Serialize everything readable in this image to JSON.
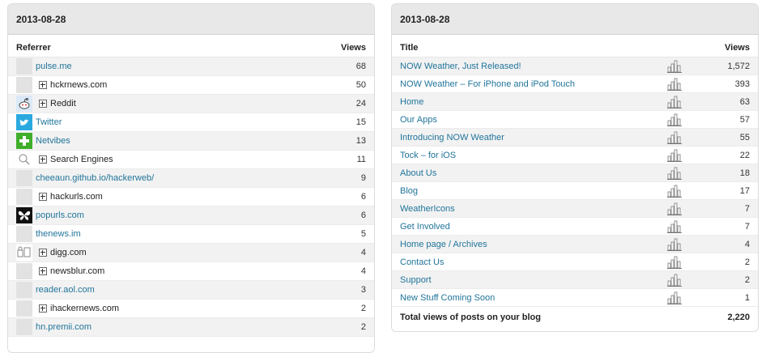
{
  "left": {
    "date": "2013-08-28",
    "col_referrer": "Referrer",
    "col_views": "Views",
    "rows": [
      {
        "label": "pulse.me",
        "views": "68",
        "kind": "link",
        "icon": "blank-icon"
      },
      {
        "label": "hckrnews.com",
        "views": "50",
        "kind": "expand",
        "icon": "blank-icon"
      },
      {
        "label": "Reddit",
        "views": "24",
        "kind": "expand",
        "icon": "reddit-icon"
      },
      {
        "label": "Twitter",
        "views": "15",
        "kind": "link",
        "icon": "twitter-icon"
      },
      {
        "label": "Netvibes",
        "views": "13",
        "kind": "link",
        "icon": "netvibes-icon"
      },
      {
        "label": "Search Engines",
        "views": "11",
        "kind": "expand",
        "icon": "search-icon"
      },
      {
        "label": "cheeaun.github.io/hackerweb/",
        "views": "9",
        "kind": "link",
        "icon": "blank-icon"
      },
      {
        "label": "hackurls.com",
        "views": "6",
        "kind": "expand",
        "icon": "blank-icon"
      },
      {
        "label": "popurls.com",
        "views": "6",
        "kind": "link",
        "icon": "popurls-icon"
      },
      {
        "label": "thenews.im",
        "views": "5",
        "kind": "link",
        "icon": "blank-icon"
      },
      {
        "label": "digg.com",
        "views": "4",
        "kind": "expand",
        "icon": "digg-icon"
      },
      {
        "label": "newsblur.com",
        "views": "4",
        "kind": "expand",
        "icon": "blank-icon"
      },
      {
        "label": "reader.aol.com",
        "views": "3",
        "kind": "link",
        "icon": "blank-icon"
      },
      {
        "label": "ihackernews.com",
        "views": "2",
        "kind": "expand",
        "icon": "blank-icon"
      },
      {
        "label": "hn.premii.com",
        "views": "2",
        "kind": "link",
        "icon": "blank-icon"
      }
    ]
  },
  "right": {
    "date": "2013-08-28",
    "col_title": "Title",
    "col_views": "Views",
    "rows": [
      {
        "title": "NOW Weather, Just Released!",
        "views": "1,572"
      },
      {
        "title": "NOW Weather – For iPhone and iPod Touch",
        "views": "393"
      },
      {
        "title": "Home",
        "views": "63"
      },
      {
        "title": "Our Apps",
        "views": "57"
      },
      {
        "title": "Introducing NOW Weather",
        "views": "55"
      },
      {
        "title": "Tock – for iOS",
        "views": "22"
      },
      {
        "title": "About Us",
        "views": "18"
      },
      {
        "title": "Blog",
        "views": "17"
      },
      {
        "title": "WeatherIcons",
        "views": "7"
      },
      {
        "title": "Get Involved",
        "views": "7"
      },
      {
        "title": "Home page / Archives",
        "views": "4"
      },
      {
        "title": "Contact Us",
        "views": "2"
      },
      {
        "title": "Support",
        "views": "2"
      },
      {
        "title": "New Stuff Coming Soon",
        "views": "1"
      }
    ],
    "total_label": "Total views of posts on your blog",
    "total_value": "2,220"
  },
  "colors": {
    "link": "#21759b",
    "twitter": "#2aa9e0",
    "netvibes": "#3fae2a",
    "header_bg": "#e8e8e8",
    "alt_row": "#f2f2f2"
  }
}
